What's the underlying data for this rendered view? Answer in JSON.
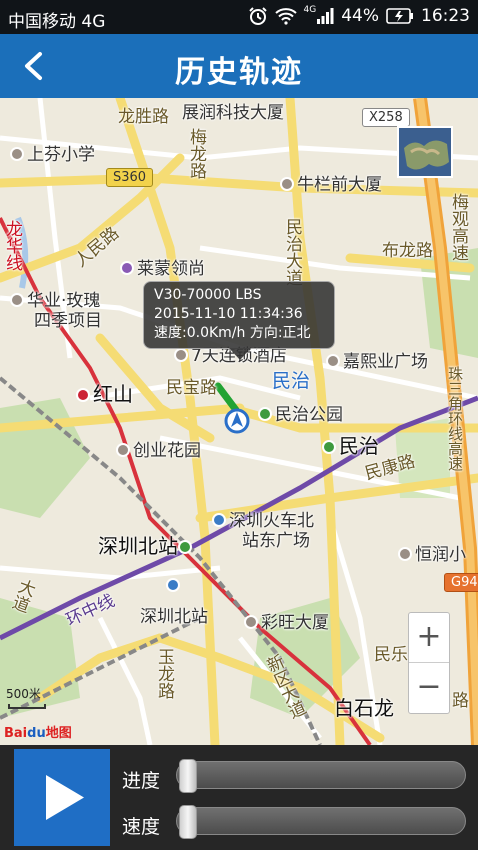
{
  "status_bar": {
    "carrier": "中国移动 4G",
    "signal_label": "4G",
    "battery": "44%",
    "time": "16:23",
    "icons": [
      "alarm-icon",
      "wifi-icon",
      "signal-icon",
      "battery-icon"
    ]
  },
  "header": {
    "title": "历史轨迹",
    "back_icon": "chevron-left-icon"
  },
  "map": {
    "road_labels": {
      "longsheng": "龙胜路",
      "meilong": "梅龙路",
      "minzhi_dadao": "民治大道",
      "bulong": "布龙路",
      "renmin": "人民路",
      "longhua": "龙华线",
      "mingbao": "民宝路",
      "minkang": "民康路",
      "huanzhong": "环中线",
      "meiguan": "梅观高速",
      "zhusanjiao": "珠三角环线高速",
      "yujin": "玉龙路",
      "xinqu": "新区大道",
      "minle": "民乐",
      "lu": "路",
      "dadao": "大道"
    },
    "poi_labels": {
      "zhanyun": "展润科技大厦",
      "shangfen": "上芬小学",
      "niulanqian": "牛栏前大厦",
      "laimeng": "莱蒙领尚",
      "huaye": "华业·玫瑰",
      "siji": "四季项目",
      "hotel": "7天连锁酒店",
      "jiaxi": "嘉熙业广场",
      "hongshan": "红山",
      "minzhi_park": "民治公园",
      "minzhi": "民治",
      "chuangye": "创业花园",
      "beizhan_east": "深圳火车北",
      "beizhan_east2": "站东广场",
      "beizhan": "深圳北站",
      "beizhan_poi": "深圳北站",
      "caiwang": "彩旺大厦",
      "baishilong": "白石龙",
      "hengshi": "恒润小",
      "minzhi_big": "民治"
    },
    "shields": {
      "s360": "S360",
      "x258": "X258",
      "g94": "G94"
    },
    "popup": {
      "line1": "V30-70000 LBS",
      "line2": "2015-11-10 11:34:36",
      "line3": "速度:0.0Km/h  方向:正北"
    },
    "scale": "500米",
    "logo_part1": "Bai",
    "logo_part2": "du",
    "logo_part3": "地图",
    "zoom_in": "+",
    "zoom_out": "−"
  },
  "controls": {
    "play_icon": "play-icon",
    "progress_label": "进度",
    "speed_label": "速度",
    "progress_value": 0,
    "speed_value": 0
  }
}
